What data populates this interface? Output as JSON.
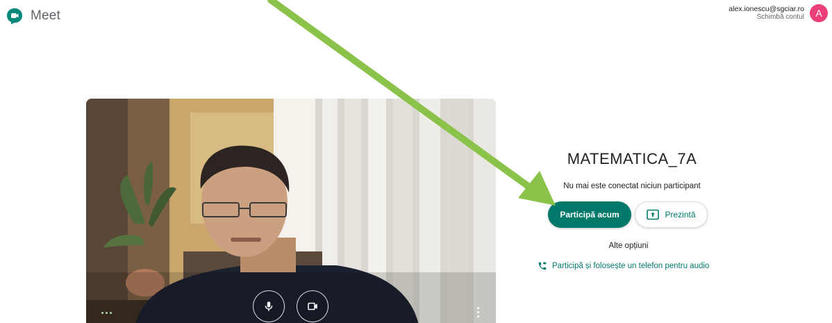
{
  "header": {
    "app_name": "Meet",
    "account_email": "alex.ionescu@sgciar.ro",
    "switch_account": "Schimbă contul",
    "avatar_letter": "A"
  },
  "meeting": {
    "title": "MATEMATICA_7A",
    "status": "Nu mai este conectat niciun participant"
  },
  "actions": {
    "join_label": "Participă acum",
    "present_label": "Prezintă",
    "other_options": "Alte opțiuni",
    "phone_label": "Participă și folosește un telefon pentru audio"
  },
  "video_controls": {
    "mic_icon": "mic-icon",
    "camera_icon": "videocam-icon",
    "more_icon": "more-vert-icon"
  },
  "colors": {
    "brand": "#00796b",
    "avatar": "#ec407a",
    "annotation_arrow": "#8bc34a"
  }
}
